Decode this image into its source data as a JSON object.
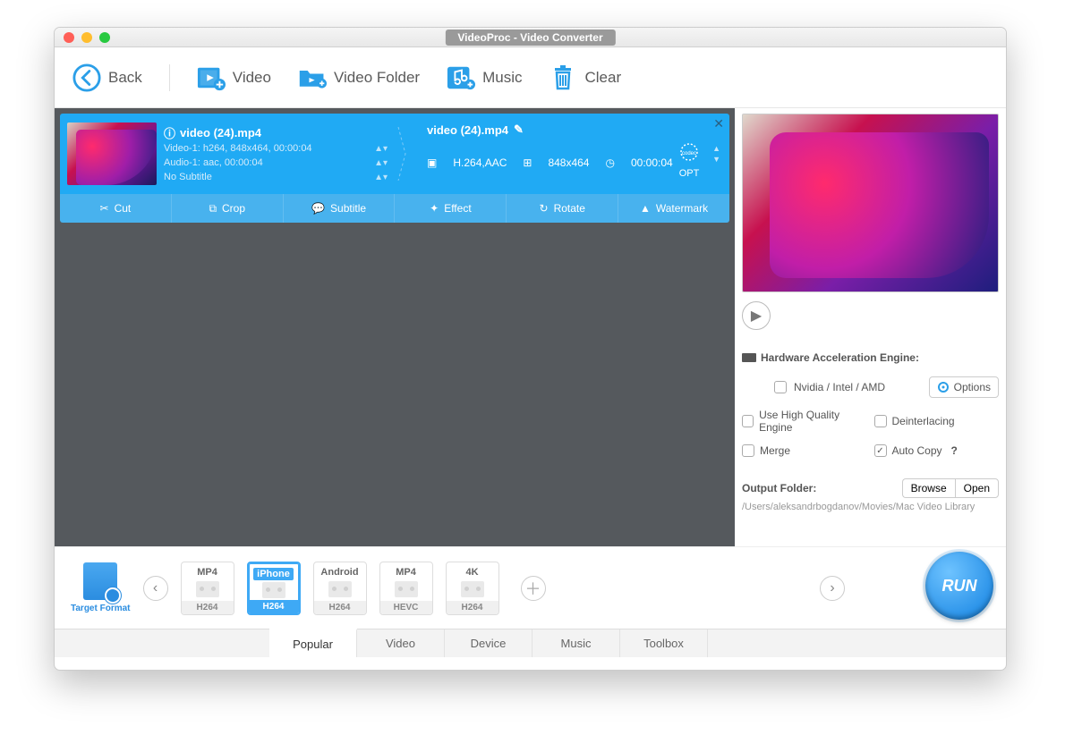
{
  "title": "VideoProc - Video Converter",
  "toolbar": {
    "back": "Back",
    "video": "Video",
    "videoFolder": "Video Folder",
    "music": "Music",
    "clear": "Clear"
  },
  "card": {
    "source": {
      "file": "video (24).mp4",
      "video": "Video-1: h264, 848x464, 00:00:04",
      "audio": "Audio-1: aac, 00:00:04",
      "subtitle": "No Subtitle"
    },
    "output": {
      "file": "video (24).mp4",
      "codec": "H.264,AAC",
      "res": "848x464",
      "dur": "00:00:04",
      "opt": "OPT"
    },
    "tools": {
      "cut": "Cut",
      "crop": "Crop",
      "subtitle": "Subtitle",
      "effect": "Effect",
      "rotate": "Rotate",
      "watermark": "Watermark"
    }
  },
  "side": {
    "hwTitle": "Hardware Acceleration Engine:",
    "hwVendors": "Nvidia / Intel / AMD",
    "options": "Options",
    "hq": "Use High Quality Engine",
    "deint": "Deinterlacing",
    "merge": "Merge",
    "autocopy": "Auto Copy",
    "outputFolder": "Output Folder:",
    "browse": "Browse",
    "open": "Open",
    "path": "/Users/aleksandrbogdanov/Movies/Mac Video Library"
  },
  "formatLabel": "Target Format",
  "formats": [
    {
      "top": "MP4",
      "bot": "H264"
    },
    {
      "top": "iPhone",
      "bot": "H264"
    },
    {
      "top": "Android",
      "bot": "H264"
    },
    {
      "top": "MP4",
      "bot": "HEVC"
    },
    {
      "top": "4K",
      "bot": "H264"
    }
  ],
  "tabs": {
    "popular": "Popular",
    "video": "Video",
    "device": "Device",
    "music": "Music",
    "toolbox": "Toolbox"
  },
  "run": "RUN"
}
